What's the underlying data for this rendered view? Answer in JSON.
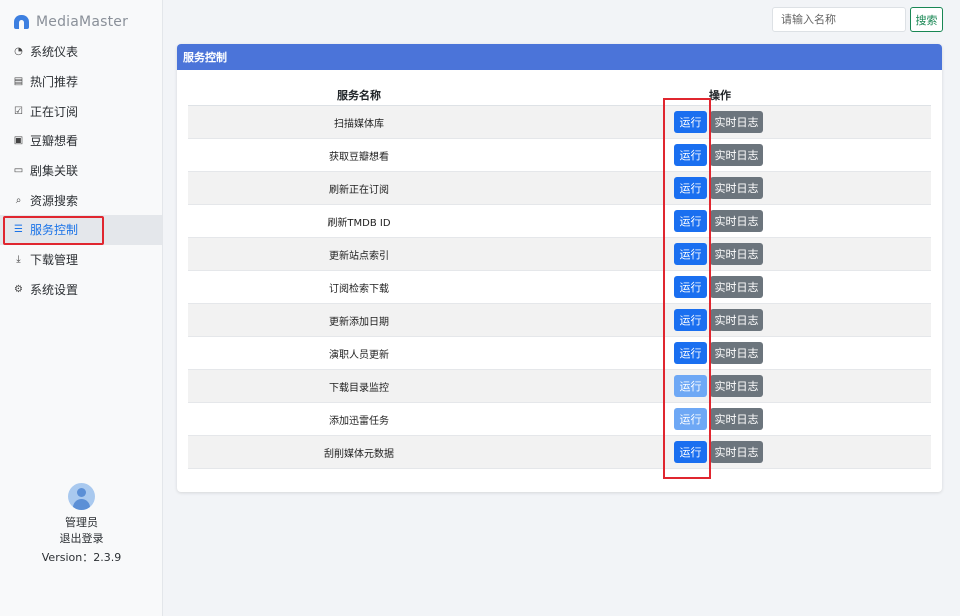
{
  "app": {
    "name": "MediaMaster"
  },
  "sidebar": {
    "items": [
      {
        "label": "系统仪表",
        "icon": "dashboard-icon",
        "glyph": "◔",
        "active": false
      },
      {
        "label": "热门推荐",
        "icon": "list-icon",
        "glyph": "▤",
        "active": false
      },
      {
        "label": "正在订阅",
        "icon": "calendar-check-icon",
        "glyph": "☑",
        "active": false
      },
      {
        "label": "豆瓣想看",
        "icon": "inbox-icon",
        "glyph": "▣",
        "active": false
      },
      {
        "label": "剧集关联",
        "icon": "card-icon",
        "glyph": "▭",
        "active": false
      },
      {
        "label": "资源搜索",
        "icon": "search-icon",
        "glyph": "⌕",
        "active": false
      },
      {
        "label": "服务控制",
        "icon": "list-bullet-icon",
        "glyph": "☰",
        "active": true
      },
      {
        "label": "下载管理",
        "icon": "download-icon",
        "glyph": "⤓",
        "active": false
      },
      {
        "label": "系统设置",
        "icon": "gear-icon",
        "glyph": "⚙",
        "active": false
      }
    ]
  },
  "user": {
    "name": "管理员",
    "logout": "退出登录",
    "version": "Version：2.3.9"
  },
  "search": {
    "placeholder": "请输入名称",
    "button": "搜索"
  },
  "panel": {
    "title": "服务控制",
    "columns": {
      "name": "服务名称",
      "operation": "操作"
    },
    "run_label": "运行",
    "log_label": "实时日志",
    "rows": [
      {
        "name": "扫描媒体库",
        "run_enabled": true
      },
      {
        "name": "获取豆瓣想看",
        "run_enabled": true
      },
      {
        "name": "刷新正在订阅",
        "run_enabled": true
      },
      {
        "name": "刷新TMDB ID",
        "run_enabled": true
      },
      {
        "name": "更新站点索引",
        "run_enabled": true
      },
      {
        "name": "订阅检索下载",
        "run_enabled": true
      },
      {
        "name": "更新添加日期",
        "run_enabled": true
      },
      {
        "name": "演职人员更新",
        "run_enabled": true
      },
      {
        "name": "下载目录监控",
        "run_enabled": false
      },
      {
        "name": "添加迅雷任务",
        "run_enabled": false
      },
      {
        "name": "刮削媒体元数据",
        "run_enabled": true
      }
    ]
  },
  "colors": {
    "accent": "#4b74d9",
    "run_button": "#1a6ff0",
    "run_button_disabled": "#6ea8f5",
    "log_button": "#6c757d",
    "highlight": "#e0262f",
    "search_green": "#198754"
  }
}
